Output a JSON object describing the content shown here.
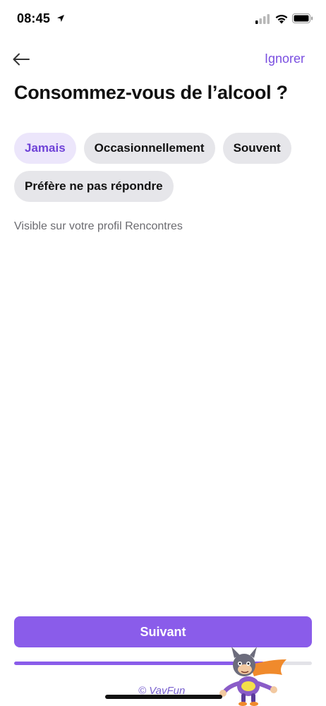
{
  "status_bar": {
    "time": "08:45",
    "icons": [
      "location-arrow-icon",
      "cell-signal-icon",
      "wifi-icon",
      "battery-icon"
    ]
  },
  "header": {
    "back_icon": "arrow-left-icon",
    "skip_label": "Ignorer"
  },
  "title": "Consommez-vous de l’alcool ?",
  "options": [
    {
      "label": "Jamais",
      "selected": true
    },
    {
      "label": "Occasionnellement",
      "selected": false
    },
    {
      "label": "Souvent",
      "selected": false
    },
    {
      "label": "Préfère ne pas répondre",
      "selected": false
    }
  ],
  "helper_text": "Visible sur votre profil Rencontres",
  "footer": {
    "next_label": "Suivant",
    "progress_percent": 84
  },
  "watermark": {
    "text": "© VavFun"
  },
  "colors": {
    "accent": "#8a5cea",
    "accent_text": "#7a4fe0",
    "chip_bg": "#e6e6ea",
    "chip_selected_bg": "#ece6fb"
  }
}
